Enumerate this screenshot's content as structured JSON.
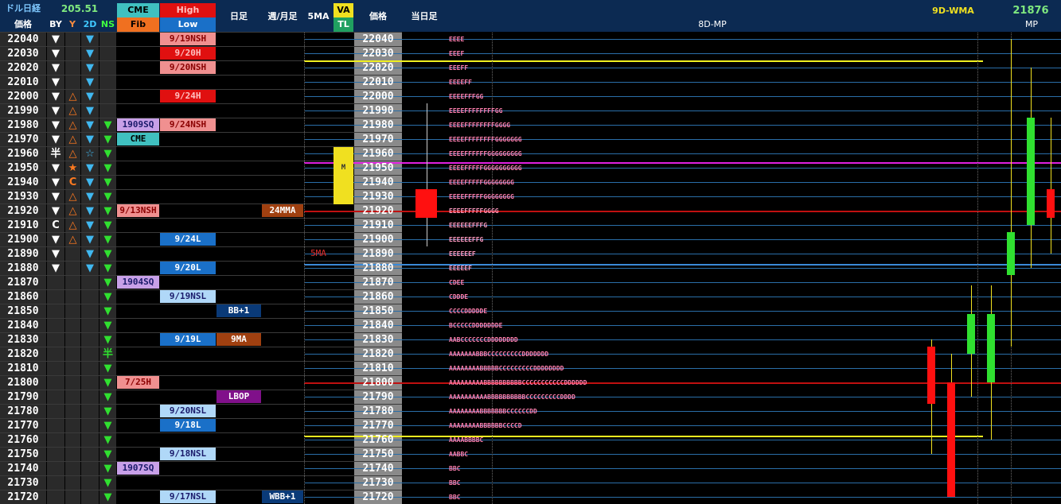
{
  "header": {
    "title": "ドル日経",
    "title_value": "205.51",
    "price_label": "価格",
    "cols": [
      "BY",
      "Y",
      "2D",
      "NS"
    ],
    "cme": "CME",
    "fib": "Fib",
    "high": "High",
    "low": "Low",
    "daily": "日足",
    "weekly_monthly": "週/月足",
    "ma5": "5MA",
    "va": "VA",
    "tl": "TL",
    "price2": "価格",
    "today": "当日足",
    "mp8d": "8D-MP",
    "wma_label": "9D-WMA",
    "wma_value": "21876",
    "mp": "MP"
  },
  "prices": [
    22040,
    22030,
    22020,
    22010,
    22000,
    21990,
    21980,
    21970,
    21960,
    21950,
    21940,
    21930,
    21920,
    21910,
    21900,
    21890,
    21880,
    21870,
    21860,
    21850,
    21840,
    21830,
    21820,
    21810,
    21800,
    21790,
    21780,
    21770,
    21760,
    21750,
    21740,
    21730,
    21720
  ],
  "by_col": [
    "▼",
    "▼",
    "▼",
    "▼",
    "▼",
    "▼",
    "▼",
    "▼",
    "半",
    "▼",
    "▼",
    "▼",
    "▼",
    "C",
    "▼",
    "▼",
    "▼",
    "",
    "",
    "",
    "",
    "",
    "",
    "",
    "",
    "",
    "",
    "",
    "",
    "",
    "",
    "",
    ""
  ],
  "y_col": [
    "",
    "",
    "",
    "",
    "△",
    "△",
    "△",
    "△",
    "△",
    "★",
    "C",
    "△",
    "△",
    "△",
    "△",
    "",
    "",
    "",
    "",
    "",
    "",
    "",
    "",
    "",
    "",
    "",
    "",
    "",
    "",
    "",
    "",
    "",
    ""
  ],
  "d2_col": [
    "▼",
    "▼",
    "▼",
    "▼",
    "▼",
    "▼",
    "▼",
    "▼",
    "☆",
    "▼",
    "▼",
    "▼",
    "▼",
    "▼",
    "▼",
    "▼",
    "▼",
    "",
    "",
    "",
    "",
    "",
    "",
    "",
    "",
    "",
    "",
    "",
    "",
    "",
    "",
    "",
    ""
  ],
  "ns_col": [
    "",
    "",
    "",
    "",
    "",
    "",
    "▼",
    "▼",
    "▼",
    "▼",
    "▼",
    "▼",
    "▼",
    "▼",
    "▼",
    "▼",
    "▼",
    "▼",
    "▼",
    "▼",
    "▼",
    "▼",
    "半",
    "▼",
    "▼",
    "▼",
    "▼",
    "▼",
    "▼",
    "▼",
    "▼",
    "▼",
    "▼"
  ],
  "fib_labels": [
    {
      "row": 6,
      "text": "1909SQ",
      "bg": "#c8a0e8",
      "fg": "#1a1a6a"
    },
    {
      "row": 7,
      "text": "CME",
      "bg": "#40c0c0",
      "fg": "#000000"
    },
    {
      "row": 12,
      "text": "9/13NSH",
      "bg": "#f09090",
      "fg": "#8a0000"
    },
    {
      "row": 17,
      "text": "1904SQ",
      "bg": "#c8a0e8",
      "fg": "#1a1a6a"
    },
    {
      "row": 24,
      "text": "7/25H",
      "bg": "#f09090",
      "fg": "#8a0000"
    },
    {
      "row": 30,
      "text": "1907SQ",
      "bg": "#c8a0e8",
      "fg": "#1a1a6a"
    }
  ],
  "hl_labels": [
    {
      "row": 0,
      "text": "9/19NSH",
      "bg": "#f09090",
      "fg": "#8a0000"
    },
    {
      "row": 1,
      "text": "9/20H",
      "bg": "#e01010",
      "fg": "#ffc0c0"
    },
    {
      "row": 2,
      "text": "9/20NSH",
      "bg": "#f09090",
      "fg": "#8a0000"
    },
    {
      "row": 4,
      "text": "9/24H",
      "bg": "#e01010",
      "fg": "#ffc0c0"
    },
    {
      "row": 6,
      "text": "9/24NSH",
      "bg": "#f09090",
      "fg": "#8a0000"
    },
    {
      "row": 14,
      "text": "9/24L",
      "bg": "#1a70c8",
      "fg": "#ffffff"
    },
    {
      "row": 16,
      "text": "9/20L",
      "bg": "#1a70c8",
      "fg": "#ffffff"
    },
    {
      "row": 18,
      "text": "9/19NSL",
      "bg": "#b0d8f8",
      "fg": "#1a1a6a"
    },
    {
      "row": 21,
      "text": "9/19L",
      "bg": "#1a70c8",
      "fg": "#ffffff"
    },
    {
      "row": 26,
      "text": "9/20NSL",
      "bg": "#b0d8f8",
      "fg": "#1a1a6a"
    },
    {
      "row": 27,
      "text": "9/18L",
      "bg": "#1a70c8",
      "fg": "#ffffff"
    },
    {
      "row": 29,
      "text": "9/18NSL",
      "bg": "#b0d8f8",
      "fg": "#1a1a6a"
    },
    {
      "row": 32,
      "text": "9/17NSL",
      "bg": "#b0d8f8",
      "fg": "#1a1a6a"
    }
  ],
  "daily_labels": [
    {
      "row": 19,
      "text": "BB+1",
      "bg": "#0a3a78",
      "fg": "#ffffff"
    },
    {
      "row": 21,
      "text": "9MA",
      "bg": "#a04010",
      "fg": "#ffffff"
    },
    {
      "row": 25,
      "text": "LBOP",
      "bg": "#80108a",
      "fg": "#ffffff"
    }
  ],
  "weekly_labels": [
    {
      "row": 12,
      "text": "24MMA",
      "bg": "#a04010",
      "fg": "#ffffff"
    },
    {
      "row": 32,
      "text": "WBB+1",
      "bg": "#0a3a78",
      "fg": "#ffffff"
    }
  ],
  "ma5_label": {
    "row": 15,
    "text": "5MA"
  },
  "va_marker": "M",
  "tpo_rows": [
    "EEEE",
    "EEEF",
    "EEEFF",
    "EEEEFF",
    "EEEEFFFGG",
    "EEEEFFFFFFFFGG",
    "EEEEFFFFFFFFGGGG",
    "EEEEFFFFFFFFGGGGGGG",
    "EEEEFFFFFFGGGGGGGGG",
    "EEEEFFFFFGGGGGGGGGG",
    "EEEEFFFFFGGGGGGGG",
    "EEEEFFFFFGGGGGGGG",
    "EEEEFFFFFGGGG",
    "EEEEEEFFFG",
    "EEEEEEFFG",
    "EEEEEEF",
    "EEEEEF",
    "CDEE",
    "CDDDE",
    "CCCCDDDDDE",
    "BCCCCCDDDDDDDE",
    "AABCCCCCCCDDDDDDDD",
    "AAAAAAABBBCCCCCCCCCDDDDDDD",
    "AAAAAAAABBBBBCCCCCCCCCDDDDDDDD",
    "AAAAAAAAABBBBBBBBBBCCCCCCCCCCCDDDDDD",
    "AAAAAAAAAABBBBBBBBBBCCCCCCCCCDDDD",
    "AAAAAAAABBBBBBBCCCCCCDD",
    "AAAAAAAABBBBBBCCCCD",
    "AAAABBBBC",
    "AABBC",
    "BBC",
    "BBC",
    "BBC"
  ]
}
